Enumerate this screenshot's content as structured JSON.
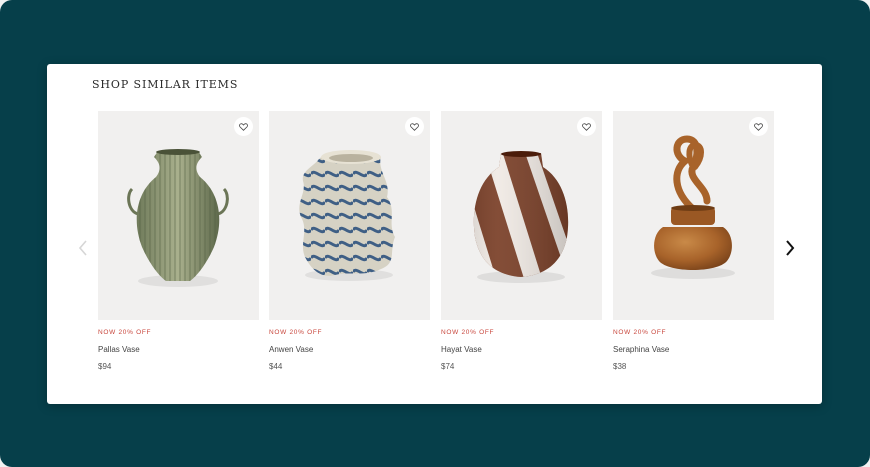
{
  "section": {
    "title": "SHOP SIMILAR ITEMS"
  },
  "carousel": {
    "prev_icon": "chevron-left-icon",
    "next_icon": "chevron-right-icon"
  },
  "products": [
    {
      "badge": "NOW 20% OFF",
      "name": "Pallas Vase",
      "price": "$94",
      "favorite_icon": "heart-icon"
    },
    {
      "badge": "NOW 20% OFF",
      "name": "Anwen Vase",
      "price": "$44",
      "favorite_icon": "heart-icon"
    },
    {
      "badge": "NOW 20% OFF",
      "name": "Hayat Vase",
      "price": "$74",
      "favorite_icon": "heart-icon"
    },
    {
      "badge": "NOW 20% OFF",
      "name": "Seraphina Vase",
      "price": "$38",
      "favorite_icon": "heart-icon"
    }
  ],
  "colors": {
    "background": "#063f4a",
    "panel": "#ffffff",
    "sale_badge": "#c8463c",
    "image_bg": "#f1f0ef"
  }
}
